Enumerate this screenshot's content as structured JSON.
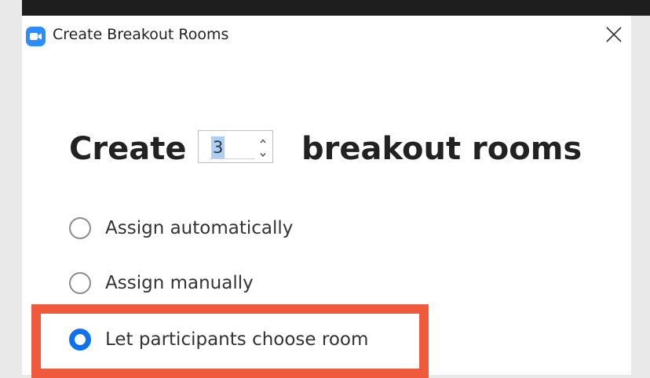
{
  "window": {
    "title": "Create Breakout Rooms",
    "app_icon": "zoom-camera-icon",
    "close_icon": "close-icon"
  },
  "heading": {
    "prefix": "Create",
    "suffix": "breakout rooms",
    "room_count": "3"
  },
  "options": [
    {
      "label": "Assign automatically",
      "selected": false
    },
    {
      "label": "Assign manually",
      "selected": false
    },
    {
      "label": "Let participants choose room",
      "selected": true
    }
  ],
  "colors": {
    "accent": "#0e72ed",
    "app_icon": "#2d8cff",
    "highlight": "#f05a3c"
  }
}
